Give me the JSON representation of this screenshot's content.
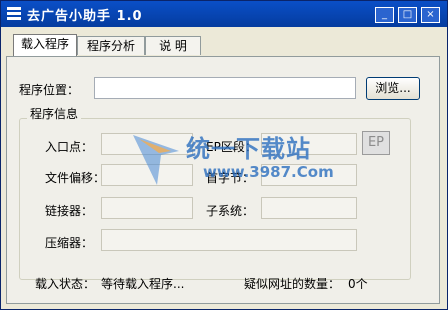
{
  "window": {
    "title": "去广告小助手 1.0",
    "controls": {
      "minimize": "_",
      "maximize": "□",
      "close": "×"
    }
  },
  "tabs": [
    {
      "label": "载入程序",
      "active": true
    },
    {
      "label": "程序分析",
      "active": false
    },
    {
      "label": "说 明",
      "active": false
    }
  ],
  "program_location": {
    "label": "程序位置：",
    "value": "",
    "browse_label": "浏览..."
  },
  "program_info": {
    "title": "程序信息",
    "entry_point_label": "入口点：",
    "ep_section_label": "EP区段：",
    "ep_button_label": "EP",
    "file_offset_label": "文件偏移：",
    "first_byte_label": "首字节：",
    "linker_label": "链接器：",
    "subsystem_label": "子系统：",
    "compressor_label": "压缩器："
  },
  "status": {
    "load_status_label": "载入状态：",
    "load_status_value": "等待载入程序...",
    "suspect_url_label": "疑似网址的数量：",
    "suspect_url_count": "0个"
  },
  "watermark": {
    "text": "统一下载站",
    "url": "www.3987.Com"
  }
}
